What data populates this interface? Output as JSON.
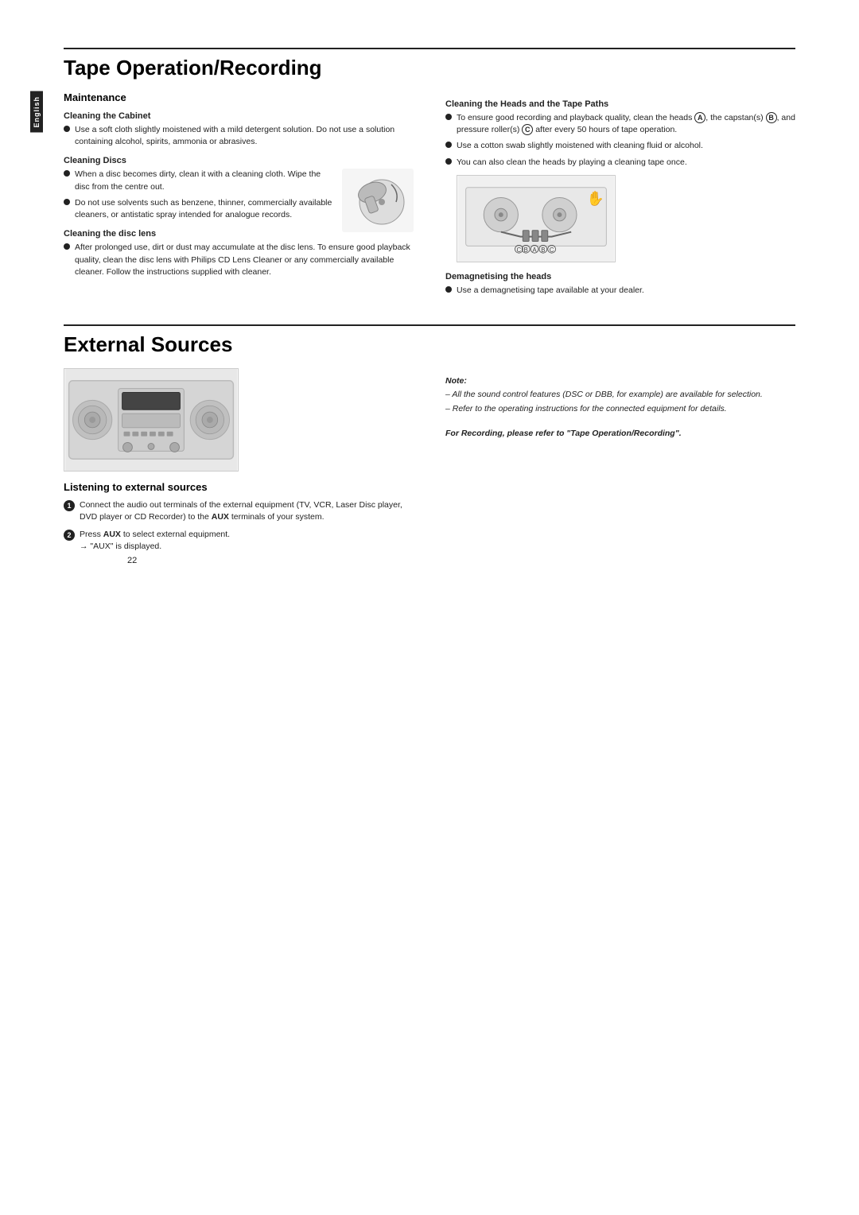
{
  "page": {
    "number": "22"
  },
  "tape_section": {
    "title": "Tape Operation/Recording",
    "maintenance": {
      "heading": "Maintenance",
      "cleaning_cabinet": {
        "title": "Cleaning the Cabinet",
        "bullets": [
          "Use a soft cloth slightly moistened with a mild detergent solution. Do not use a solution containing alcohol, spirits, ammonia or abrasives."
        ]
      },
      "cleaning_discs": {
        "title": "Cleaning Discs",
        "bullets": [
          "When a disc becomes dirty, clean it with a cleaning cloth. Wipe the disc from the centre out.",
          "Do not use solvents such as benzene, thinner, commercially available cleaners, or antistatic spray intended for analogue records."
        ]
      },
      "cleaning_disc_lens": {
        "title": "Cleaning the disc lens",
        "bullets": [
          "After prolonged use, dirt or dust may accumulate at the disc lens. To ensure good playback quality, clean the disc lens with Philips CD Lens Cleaner or any commercially available cleaner. Follow the instructions supplied with cleaner."
        ]
      }
    },
    "cleaning_heads": {
      "title": "Cleaning the Heads and the Tape Paths",
      "bullets": [
        "To ensure good recording and playback quality, clean the heads (A), the capstan(s) (B), and pressure roller(s) (C) after every 50 hours of tape operation.",
        "Use a cotton swab slightly moistened with cleaning fluid or alcohol.",
        "You can also clean the heads by playing a cleaning tape once."
      ],
      "demagnetising": {
        "title": "Demagnetising the heads",
        "bullets": [
          "Use a demagnetising tape available at your dealer."
        ]
      }
    },
    "lang": "English"
  },
  "external_sources": {
    "title": "External Sources",
    "listening": {
      "heading": "Listening to external sources",
      "steps": [
        "Connect the audio out terminals of the external equipment (TV, VCR, Laser Disc player, DVD player or CD Recorder) to the AUX terminals of your system.",
        "Press AUX to select external equipment. → \"AUX\" is displayed."
      ]
    },
    "note": {
      "title": "Note:",
      "lines": [
        "– All the sound control features (DSC or DBB, for example) are available for selection.",
        "– Refer to the operating instructions for the connected equipment for details."
      ]
    },
    "for_recording": "For Recording, please refer to \"Tape Operation/Recording\"."
  }
}
